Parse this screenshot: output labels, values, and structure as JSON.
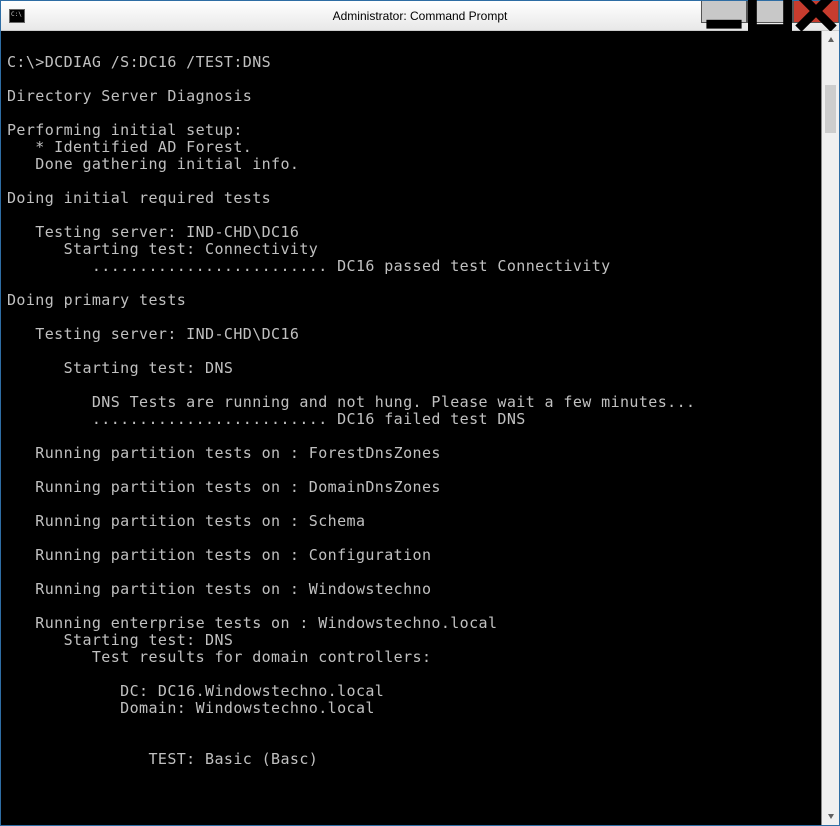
{
  "window": {
    "title": "Administrator: Command Prompt"
  },
  "console": {
    "lines": [
      "",
      "C:\\>DCDIAG /S:DC16 /TEST:DNS",
      "",
      "Directory Server Diagnosis",
      "",
      "Performing initial setup:",
      "   * Identified AD Forest.",
      "   Done gathering initial info.",
      "",
      "Doing initial required tests",
      "",
      "   Testing server: IND-CHD\\DC16",
      "      Starting test: Connectivity",
      "         ......................... DC16 passed test Connectivity",
      "",
      "Doing primary tests",
      "",
      "   Testing server: IND-CHD\\DC16",
      "",
      "      Starting test: DNS",
      "",
      "         DNS Tests are running and not hung. Please wait a few minutes...",
      "         ......................... DC16 failed test DNS",
      "",
      "   Running partition tests on : ForestDnsZones",
      "",
      "   Running partition tests on : DomainDnsZones",
      "",
      "   Running partition tests on : Schema",
      "",
      "   Running partition tests on : Configuration",
      "",
      "   Running partition tests on : Windowstechno",
      "",
      "   Running enterprise tests on : Windowstechno.local",
      "      Starting test: DNS",
      "         Test results for domain controllers:",
      "",
      "            DC: DC16.Windowstechno.local",
      "            Domain: Windowstechno.local",
      "",
      "",
      "               TEST: Basic (Basc)"
    ]
  }
}
